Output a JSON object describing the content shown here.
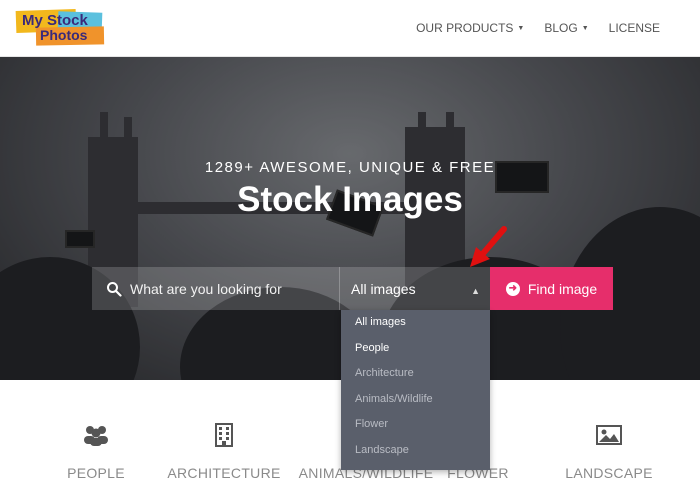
{
  "header": {
    "logo_line1": "My Stock",
    "logo_line2": "Photos",
    "nav": [
      {
        "label": "OUR PRODUCTS",
        "has_caret": true
      },
      {
        "label": "BLOG",
        "has_caret": true
      },
      {
        "label": "LICENSE",
        "has_caret": false
      }
    ],
    "search_icon": "search-icon"
  },
  "hero": {
    "tagline": "1289+ AWESOME, UNIQUE & FREE",
    "title": "Stock Images",
    "search_placeholder": "What are you looking for",
    "select_value": "All images",
    "find_button": "Find image"
  },
  "dropdown": {
    "options": [
      "All images",
      "People",
      "Architecture",
      "Animals/Wildlife",
      "Flower",
      "Landscape"
    ]
  },
  "categories": [
    {
      "label": "PEOPLE",
      "icon": "people-icon"
    },
    {
      "label": "ARCHITECTURE",
      "icon": "building-icon"
    },
    {
      "label": "ANIMALS/WILDLIFE",
      "icon": "animal-icon"
    },
    {
      "label": "FLOWER",
      "icon": "leaf-icon"
    },
    {
      "label": "LANDSCAPE",
      "icon": "landscape-icon"
    }
  ],
  "colors": {
    "accent": "#e62e6b",
    "dropdown_bg": "#5a5f6b"
  }
}
